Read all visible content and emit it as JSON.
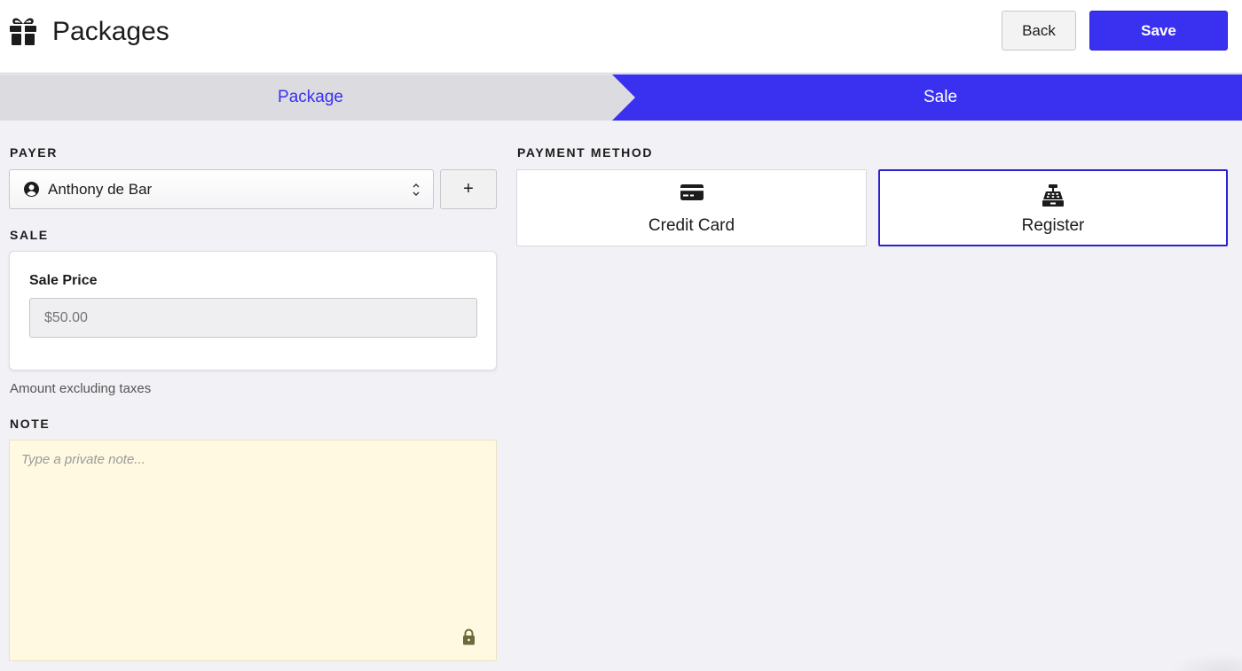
{
  "header": {
    "title": "Packages",
    "icon": "gift-icon",
    "back_label": "Back",
    "save_label": "Save"
  },
  "steps": [
    {
      "label": "Package",
      "active": false
    },
    {
      "label": "Sale",
      "active": true
    }
  ],
  "payer": {
    "section_label": "PAYER",
    "selected": "Anthony de Bar",
    "add_label": "+"
  },
  "sale": {
    "section_label": "SALE",
    "price_label": "Sale Price",
    "price_placeholder": "$50.00",
    "hint": "Amount excluding taxes"
  },
  "note": {
    "section_label": "NOTE",
    "placeholder": "Type a private note..."
  },
  "payment": {
    "section_label": "PAYMENT METHOD",
    "options": [
      {
        "label": "Credit Card",
        "icon": "credit-card-icon",
        "selected": false
      },
      {
        "label": "Register",
        "icon": "cash-register-icon",
        "selected": true
      }
    ]
  },
  "colors": {
    "accent": "#3a30f0",
    "background": "#f2f1f5",
    "note_background": "#fef9e0",
    "step_inactive": "#dcdbe0"
  }
}
